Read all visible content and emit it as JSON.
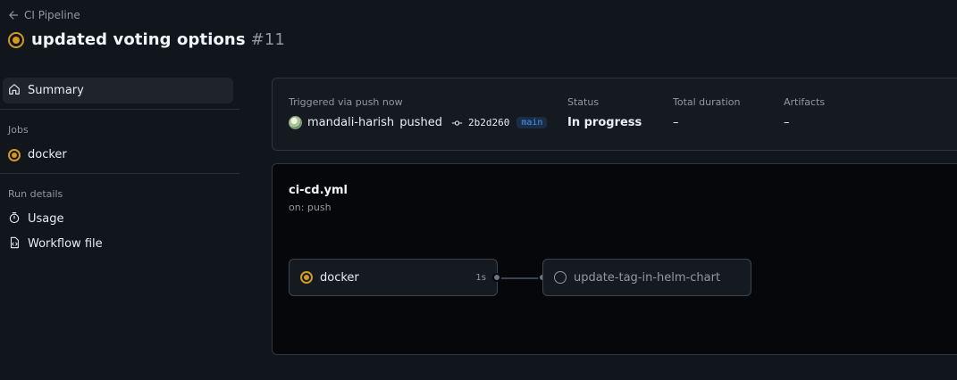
{
  "header": {
    "back_label": "CI Pipeline",
    "run_title": "updated voting options",
    "run_number": "#11"
  },
  "sidebar": {
    "summary_label": "Summary",
    "jobs_heading": "Jobs",
    "jobs": [
      {
        "label": "docker",
        "status": "in-progress"
      }
    ],
    "run_details_heading": "Run details",
    "run_details": [
      {
        "label": "Usage",
        "icon": "stopwatch-icon"
      },
      {
        "label": "Workflow file",
        "icon": "file-code-icon"
      }
    ]
  },
  "summary": {
    "trigger_label": "Triggered via push now",
    "actor": "mandali-harish",
    "action": "pushed",
    "commit_sha": "2b2d260",
    "branch": "main",
    "status_label": "Status",
    "status_value": "In progress",
    "duration_label": "Total duration",
    "duration_value": "–",
    "artifacts_label": "Artifacts",
    "artifacts_value": "–"
  },
  "workflow": {
    "file_name": "ci-cd.yml",
    "trigger": "on: push",
    "jobs": [
      {
        "name": "docker",
        "duration": "1s",
        "status": "in-progress"
      },
      {
        "name": "update-tag-in-helm-chart",
        "duration": "",
        "status": "pending"
      }
    ]
  },
  "colors": {
    "background": "#11151c",
    "in_progress": "#d29922",
    "muted_text": "#9198a1",
    "branch_text": "#4493f8",
    "border": "#30363d"
  }
}
